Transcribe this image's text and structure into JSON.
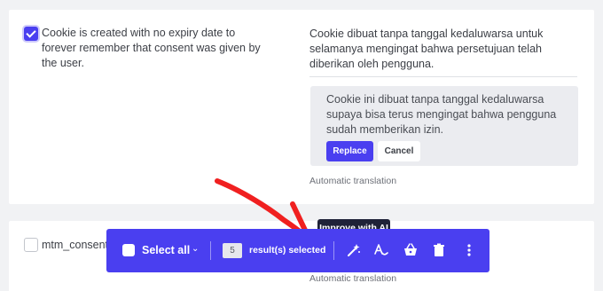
{
  "row1": {
    "source_text": "Cookie is created with no expiry date to forever remember that consent was given by the user.",
    "translation_text": "Cookie dibuat tanpa tanggal kedaluwarsa untuk selamanya mengingat bahwa persetujuan telah diberikan oleh pengguna.",
    "suggestion_text": "Cookie ini dibuat tanpa tanggal kedaluwarsa supaya bisa terus mengingat bahwa pengguna sudah memberikan izin.",
    "replace_label": "Replace",
    "cancel_label": "Cancel",
    "auto_translation_label": "Automatic translation"
  },
  "row2": {
    "source_text": "mtm_consent",
    "auto_translation_label": "Automatic translation"
  },
  "tooltip": {
    "text": "Improve with AI"
  },
  "toolbar": {
    "select_all_label": "Select all",
    "count": "5",
    "results_label": "result(s) selected",
    "icons": [
      "improve-ai-icon",
      "spellcheck-icon",
      "basket-icon",
      "trash-icon",
      "more-vertical-icon"
    ]
  },
  "colors": {
    "accent": "#4a3ff0",
    "annotation_arrow": "#f02020",
    "tooltip_bg": "#1f2238"
  }
}
